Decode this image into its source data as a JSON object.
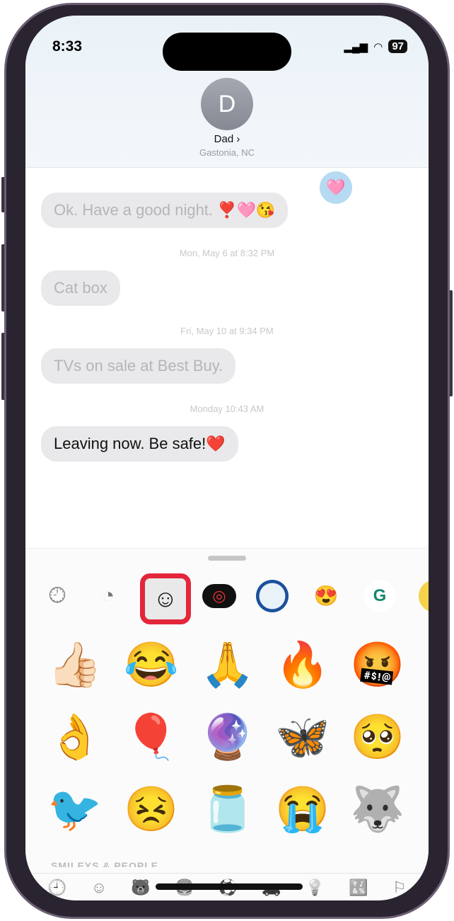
{
  "status": {
    "time": "8:33",
    "battery": "97"
  },
  "contact": {
    "initial": "D",
    "name": "Dad ›",
    "location": "Gastonia, NC"
  },
  "messages": [
    {
      "text": "Ok.  Have a good night.  ❣️🩷😘",
      "active": false
    },
    {
      "timestamp": "Mon, May 6 at 8:32 PM"
    },
    {
      "text": "Cat box",
      "active": false
    },
    {
      "timestamp": "Fri, May 10 at 9:34 PM"
    },
    {
      "text": "TVs on sale at Best Buy.",
      "active": false
    },
    {
      "timestamp": "Monday 10:43 AM"
    },
    {
      "text": "Leaving now.  Be safe!❤️",
      "active": true
    }
  ],
  "tapback": "🩷",
  "categories": [
    "clock-icon",
    "sticker-icon",
    "emoji-icon",
    "activity-icon",
    "app-icon",
    "memoji-icon",
    "grammarly-icon"
  ],
  "emojis": [
    "👍🏻",
    "😂",
    "🙏",
    "🔥",
    "🤬",
    "👌",
    "🎈",
    "🔮",
    "🦋",
    "🥺",
    "🐦",
    "😣",
    "🫙",
    "😭",
    "🐺"
  ],
  "section_label": "SMILEYS & PEOPLE",
  "bottom_tabs": [
    "🕘",
    "☺",
    "🐻",
    "🍔",
    "⚽",
    "🚗",
    "💡",
    "🔣",
    "⚐"
  ],
  "colors": {
    "highlight": "#e3263a"
  }
}
